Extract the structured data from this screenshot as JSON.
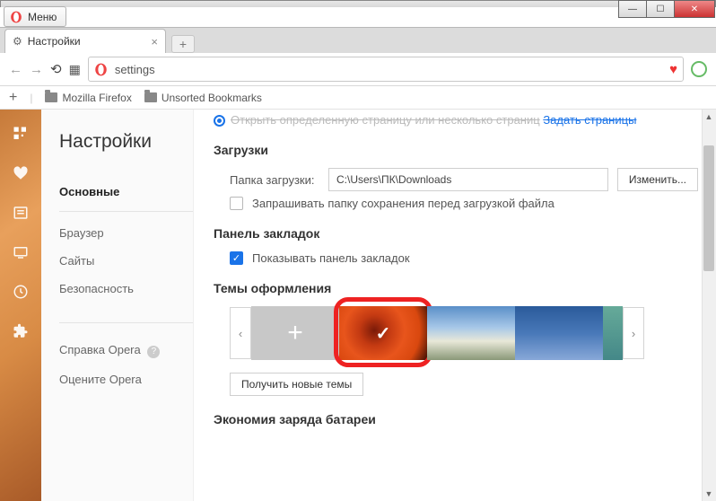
{
  "window": {
    "menu_label": "Меню"
  },
  "tab": {
    "title": "Настройки"
  },
  "addressbar": {
    "text": "settings"
  },
  "bookmarks": {
    "folder1": "Mozilla Firefox",
    "folder2": "Unsorted Bookmarks"
  },
  "rail_icons": [
    "grid",
    "heart",
    "news",
    "screen",
    "clock",
    "puzzle"
  ],
  "sidebar": {
    "title": "Настройки",
    "items": [
      "Основные",
      "Браузер",
      "Сайты",
      "Безопасность"
    ],
    "help": "Справка Opera",
    "rate": "Оцените Opera"
  },
  "content": {
    "truncated_text": "Открыть определенную страницу или несколько страниц",
    "truncated_link": "Задать страницы",
    "downloads": {
      "title": "Загрузки",
      "folder_label": "Папка загрузки:",
      "folder_value": "C:\\Users\\ПК\\Downloads",
      "change_btn": "Изменить...",
      "ask_checkbox": "Запрашивать папку сохранения перед загрузкой файла"
    },
    "bookmarks_panel": {
      "title": "Панель закладок",
      "show_checkbox": "Показывать панель закладок"
    },
    "themes": {
      "title": "Темы оформления",
      "get_more_btn": "Получить новые темы"
    },
    "battery": {
      "title": "Экономия заряда батареи"
    }
  }
}
